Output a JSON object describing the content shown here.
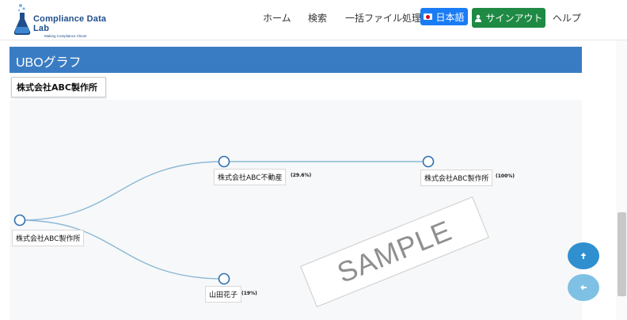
{
  "brand": {
    "title": "Compliance Data Lab",
    "subtitle": "Making Compliance Clever"
  },
  "nav": {
    "home": "ホーム",
    "search": "検索",
    "bulk": "一括ファイル処理",
    "language": "日本語",
    "signout": "サインアウト",
    "help": "ヘルプ"
  },
  "page": {
    "title": "UBOグラフ",
    "company": "株式会社ABC製作所"
  },
  "graph": {
    "root_label": "株式会社ABC製作所",
    "nodes": [
      {
        "label": "株式会社ABC不動産",
        "pct": "(29.6%)"
      },
      {
        "label": "株式会社ABC製作所",
        "pct": "(100%)"
      },
      {
        "label": "山田花子",
        "pct": "(19%)"
      }
    ],
    "watermark": "SAMPLE"
  },
  "colors": {
    "header": "#3a7cc4",
    "lang_btn": "#1a7cf5",
    "signout_btn": "#1e8a44",
    "edge": "#8bb8d6",
    "node_stroke": "#2f6fb0"
  },
  "icons": {
    "up": "arrow-up-icon",
    "back": "arrow-left-icon",
    "user": "user-icon"
  }
}
